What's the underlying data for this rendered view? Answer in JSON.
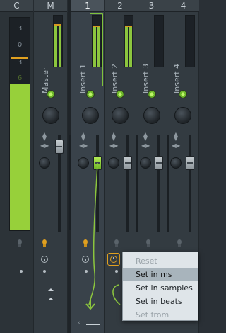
{
  "mixer": {
    "headers": [
      "C",
      "M",
      "1",
      "2",
      "3",
      "4"
    ],
    "master_scale": [
      "3",
      "0",
      "3",
      "6"
    ],
    "tracks": {
      "master": "Master",
      "insert1": "Insert 1",
      "insert2": "Insert 2",
      "insert3": "Insert 3",
      "insert4": "Insert 4"
    },
    "selected_track": "Insert 1",
    "master_level": 0.66,
    "accent_color": "#8cc63e",
    "peak_color": "#e0a020",
    "icons": [
      "bulb-icon",
      "clock-icon",
      "chevron-up-icon",
      "arrow-down-icon",
      "knob-icon",
      "led-icon"
    ]
  },
  "context_menu": {
    "items": [
      {
        "label": "Reset",
        "enabled": false,
        "highlighted": false
      },
      {
        "label": "Set in ms",
        "enabled": true,
        "highlighted": true
      },
      {
        "label": "Set in samples",
        "enabled": true,
        "highlighted": false
      },
      {
        "label": "Set in beats",
        "enabled": true,
        "highlighted": false
      },
      {
        "label": "Set from",
        "enabled": false,
        "highlighted": false
      }
    ]
  }
}
